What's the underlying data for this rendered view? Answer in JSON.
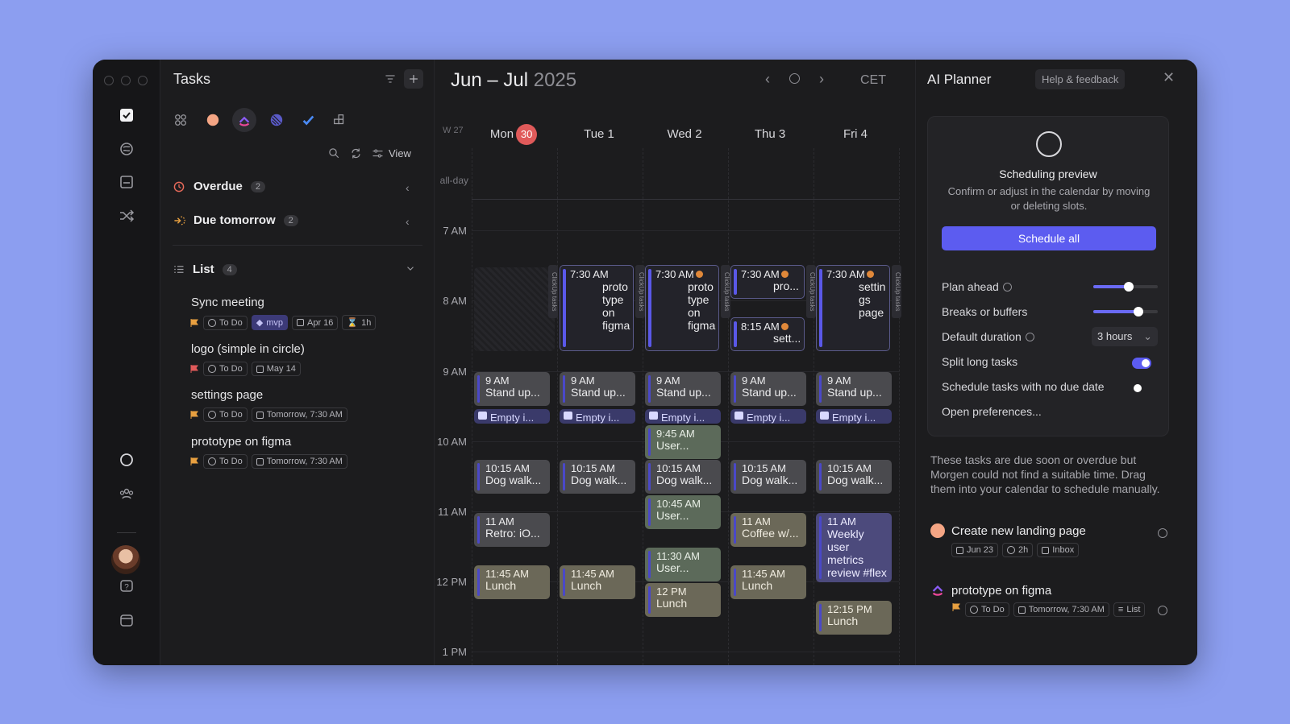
{
  "tasks_panel": {
    "title": "Tasks",
    "view_label": "View",
    "overdue": {
      "label": "Overdue",
      "count": "2"
    },
    "due_tomorrow": {
      "label": "Due tomorrow",
      "count": "2"
    },
    "list": {
      "label": "List",
      "count": "4"
    },
    "items": [
      {
        "name": "Sync meeting",
        "status": "To Do",
        "tag": "mvp",
        "date": "Apr 16",
        "duration": "1h"
      },
      {
        "name": "logo (simple in circle)",
        "status": "To Do",
        "date": "May 14"
      },
      {
        "name": "settings page",
        "status": "To Do",
        "date": "Tomorrow, 7:30 AM"
      },
      {
        "name": "prototype on figma",
        "status": "To Do",
        "date": "Tomorrow, 7:30 AM"
      }
    ]
  },
  "calendar": {
    "title_range": "Jun – Jul",
    "title_year": "2025",
    "timezone": "CET",
    "week": "W 27",
    "allday_label": "all-day",
    "days": [
      {
        "label": "Mon",
        "badge": "30"
      },
      {
        "label": "Tue 1"
      },
      {
        "label": "Wed 2"
      },
      {
        "label": "Thu 3"
      },
      {
        "label": "Fri 4"
      }
    ],
    "hours": [
      "7 AM",
      "8 AM",
      "9 AM",
      "10 AM",
      "11 AM",
      "12 PM",
      "1 PM"
    ],
    "side_tag": "ClickUp tasks",
    "events": {
      "standup_time": "9 AM",
      "standup": "Stand up...",
      "empty": "Empty i...",
      "dogwalk_time": "10:15 AM",
      "dogwalk": "Dog walk...",
      "mon_retro_time": "11 AM",
      "mon_retro": "Retro: iO...",
      "lunch_1145": "11:45 AM",
      "lunch": "Lunch",
      "tue_ai_time": "7:30 AM",
      "tue_ai": "proto type on figma",
      "wed_ai_time": "7:30 AM",
      "wed_ai": "proto type on figma",
      "wed_user1_time": "9:45 AM",
      "wed_user1": "User...",
      "wed_user2_time": "10:45 AM",
      "wed_user2": "User...",
      "wed_user3_time": "11:30 AM",
      "wed_user3": "User...",
      "wed_lunch_time": "12 PM",
      "thu_ai1_time": "7:30 AM",
      "thu_ai1": "pro...",
      "thu_ai2_time": "8:15 AM",
      "thu_ai2": "sett...",
      "thu_coffee_time": "11 AM",
      "thu_coffee": "Coffee w/...",
      "fri_ai_time": "7:30 AM",
      "fri_ai": "settin gs page",
      "fri_weekly_time": "11 AM",
      "fri_weekly": "Weekly user metrics review #flex",
      "fri_lunch_time": "12:15 PM"
    }
  },
  "planner": {
    "title": "AI Planner",
    "help": "Help & feedback",
    "preview_title": "Scheduling preview",
    "preview_desc": "Confirm or adjust in the calendar by moving or deleting slots.",
    "schedule_all": "Schedule all",
    "plan_ahead": "Plan ahead",
    "plan_ahead_level": 0.55,
    "breaks": "Breaks or buffers",
    "breaks_level": 0.7,
    "default_duration": "Default duration",
    "duration_value": "3 hours",
    "split": "Split long tasks",
    "split_on": true,
    "no_due": "Schedule tasks with no due date",
    "no_due_on": false,
    "open_prefs": "Open preferences...",
    "note": "These tasks are due soon or overdue but Morgen could not find a suitable time. Drag them into your calendar to schedule manually.",
    "unscheduled": [
      {
        "name": "Create new landing page",
        "date": "Jun 23",
        "duration": "2h",
        "list": "Inbox"
      },
      {
        "name": "prototype on figma",
        "status": "To Do",
        "date": "Tomorrow, 7:30 AM",
        "list": "List"
      }
    ]
  },
  "colors": {
    "accent": "#5c5cf0",
    "today": "#e05a5a",
    "background": "#8c9ef0"
  }
}
